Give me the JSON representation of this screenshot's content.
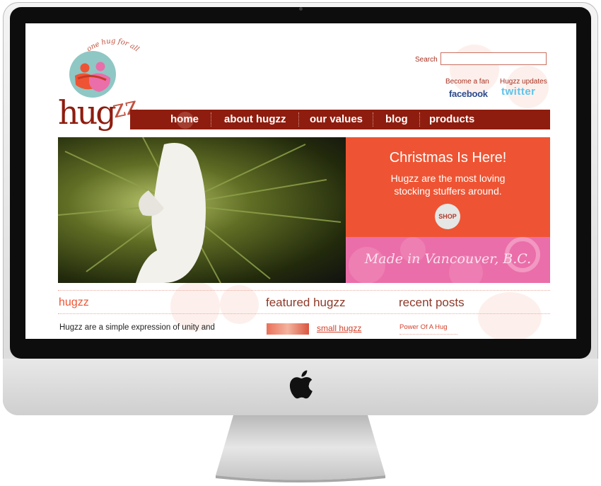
{
  "site": {
    "tagline": "one hug for all",
    "logo_text": "hugzz"
  },
  "header": {
    "search_label": "Search",
    "search_value": "",
    "fan_text": "Become a fan",
    "facebook_label": "facebook",
    "updates_text": "Hugzz updates",
    "twitter_label": "twitter"
  },
  "nav": {
    "items": [
      {
        "label": "home"
      },
      {
        "label": "about hugzz"
      },
      {
        "label": "our values"
      },
      {
        "label": "blog"
      },
      {
        "label": "products"
      }
    ]
  },
  "promo": {
    "title": "Christmas Is Here!",
    "line1": "Hugzz are the most loving",
    "line2": "stocking stuffers around.",
    "button": "SHOP",
    "made_in": "Made in Vancouver, B.C."
  },
  "sections": {
    "about_title": "hugzz",
    "about_text": "Hugzz are a simple expression of unity and",
    "featured_title": "featured hugzz",
    "featured_item": "small hugzz",
    "recent_title": "recent posts",
    "recent_post": "Power Of A Hug"
  },
  "colors": {
    "brand_red": "#8e1d0f",
    "promo_orange": "#ee5433",
    "promo_pink": "#ea6ea9",
    "accent_teal": "#8fc7c4",
    "facebook_blue": "#2c4a8c",
    "twitter_blue": "#5ec3ea"
  }
}
